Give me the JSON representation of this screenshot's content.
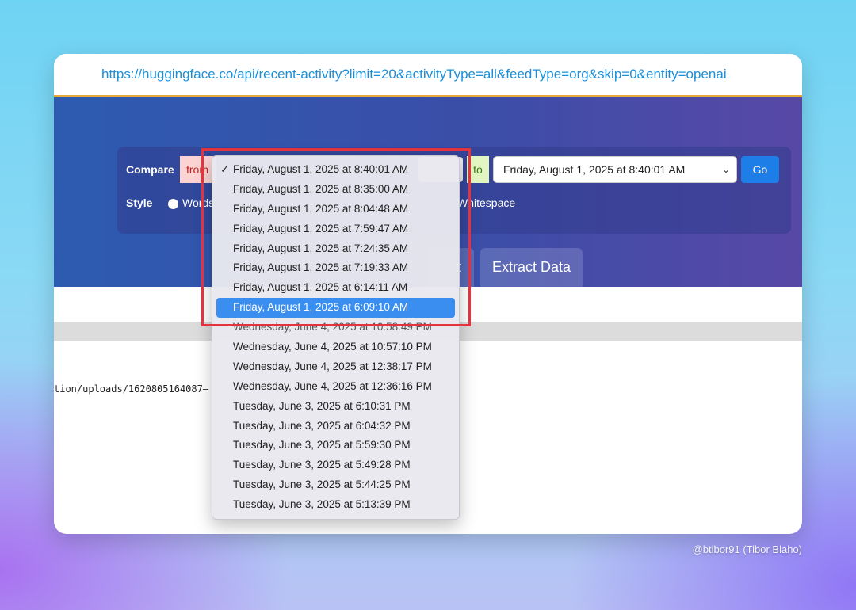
{
  "url": "https://huggingface.co/api/recent-activity?limit=20&activityType=all&feedType=org&skip=0&entity=openai",
  "compare": {
    "label": "Compare",
    "from_label": "from",
    "to_label": "to",
    "to_value": "Friday, August 1, 2025 at 8:40:01 AM",
    "go_label": "Go"
  },
  "style": {
    "label": "Style",
    "words_label": "Words",
    "whitespace_label": "Whitespace"
  },
  "tabs": {
    "partial_label": "t",
    "extract_label": "Extract Data"
  },
  "code_line": "tion/uploads/1620805164087—",
  "dropdown": {
    "check_glyph": "✓",
    "items": [
      "Friday, August 1, 2025 at 8:40:01 AM",
      "Friday, August 1, 2025 at 8:35:00 AM",
      "Friday, August 1, 2025 at 8:04:48 AM",
      "Friday, August 1, 2025 at 7:59:47 AM",
      "Friday, August 1, 2025 at 7:24:35 AM",
      "Friday, August 1, 2025 at 7:19:33 AM",
      "Friday, August 1, 2025 at 6:14:11 AM",
      "Friday, August 1, 2025 at 6:09:10 AM",
      "Wednesday, June 4, 2025 at 10:58:49 PM",
      "Wednesday, June 4, 2025 at 10:57:10 PM",
      "Wednesday, June 4, 2025 at 12:38:17 PM",
      "Wednesday, June 4, 2025 at 12:36:16 PM",
      "Tuesday, June 3, 2025 at 6:10:31 PM",
      "Tuesday, June 3, 2025 at 6:04:32 PM",
      "Tuesday, June 3, 2025 at 5:59:30 PM",
      "Tuesday, June 3, 2025 at 5:49:28 PM",
      "Tuesday, June 3, 2025 at 5:44:25 PM",
      "Tuesday, June 3, 2025 at 5:13:39 PM"
    ]
  },
  "credit": "@btibor91 (Tibor Blaho)",
  "colors": {
    "accent": "#1c7ee6",
    "highlight": "#3a8ef0",
    "annotation": "#e2333f"
  }
}
